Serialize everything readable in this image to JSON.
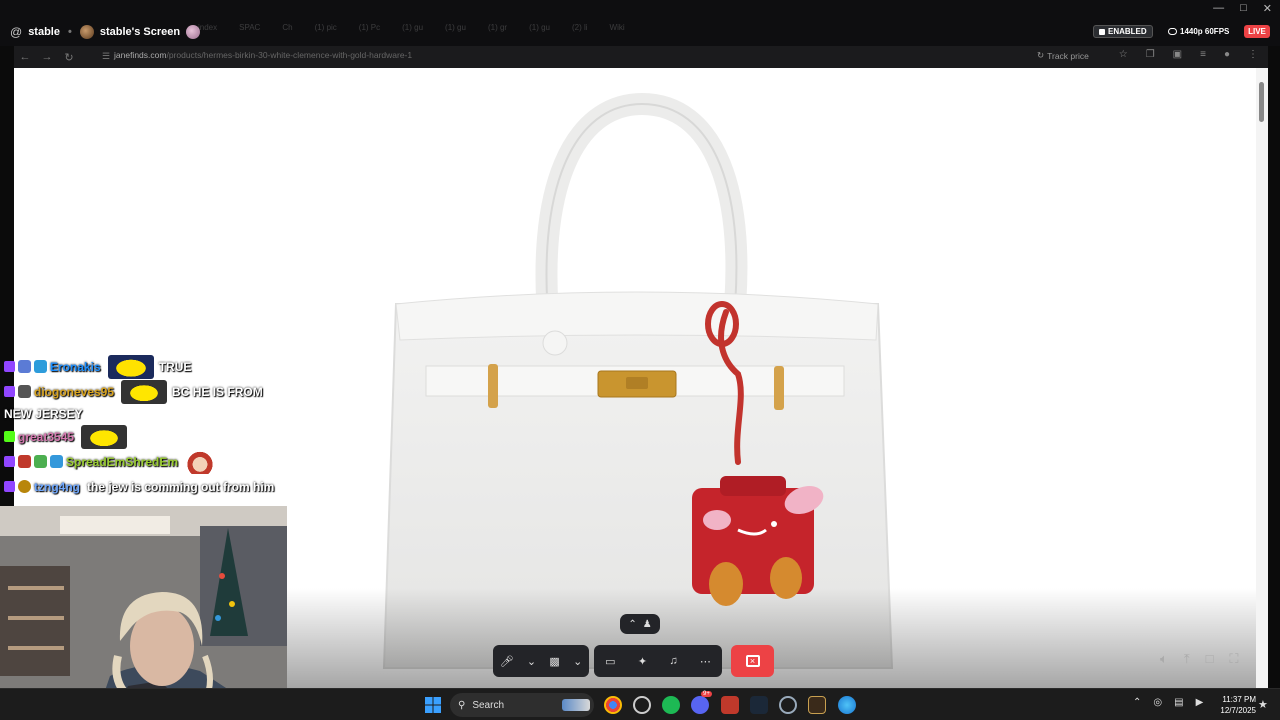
{
  "window": {
    "channel_name": "stable",
    "screen_title": "stable's Screen",
    "status_enabled": "ENABLED",
    "stream_quality": "1440p 60FPS",
    "live_label": "LIVE",
    "ghost_tabs": [
      "index",
      "SPAC",
      "Ch",
      "(1) pic",
      "(1) Pc",
      "(1) gu",
      "(1) gu",
      "(1) gr",
      "(1) gu",
      "(2) li",
      "Wiki"
    ]
  },
  "browser": {
    "url_domain": "janefinds.com",
    "url_path": "/products/hermes-birkin-30-white-clemence-with-gold-hardware-1",
    "track_price_label": "Track price"
  },
  "chat": [
    {
      "user": "Eronakis",
      "user_color": "#1e90ff",
      "platform": "twitch",
      "emote": "yellow",
      "message": "TRUE"
    },
    {
      "user": "diogoneves95",
      "user_color": "#daa520",
      "platform": "twitch",
      "emote": "yellow2",
      "message": "BC HE IS FROM"
    },
    {
      "continuation": "NEW JERSEY"
    },
    {
      "user": "great3545",
      "user_color": "#d678b0",
      "platform": "kick",
      "emote": "yellow2",
      "message": ""
    },
    {
      "user": "SpreadEmShredEm",
      "user_color": "#9acd32",
      "platform": "twitch",
      "emote": "santa",
      "message": ""
    },
    {
      "user": "tzng4ng",
      "user_color": "#6fa8ff",
      "platform": "twitch",
      "emote": "",
      "message": "the jew is comming out from him"
    }
  ],
  "taskbar": {
    "search_placeholder": "Search",
    "time": "11:37 PM",
    "date": "12/7/2025",
    "discord_badge": "9+"
  },
  "colors": {
    "discord_red": "#ed4245",
    "twitch_purple": "#9146ff",
    "kick_green": "#53fc18",
    "page_bg": "#ffffff"
  }
}
